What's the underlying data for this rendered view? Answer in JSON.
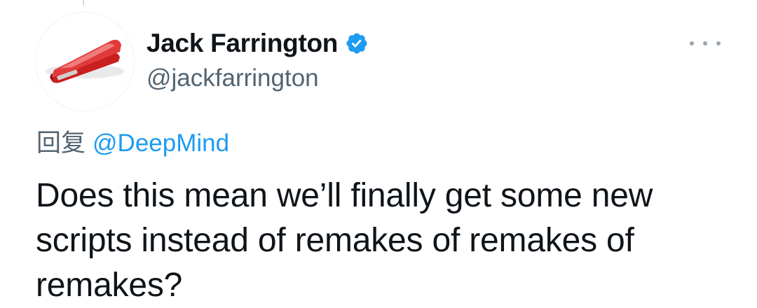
{
  "author": {
    "display_name": "Jack Farrington",
    "handle": "@jackfarrington",
    "verified": true,
    "avatar_icon": "red-stapler-avatar"
  },
  "actions": {
    "more_icon": "more-options-icon"
  },
  "reply_to": {
    "prefix": "回复",
    "mention": "@DeepMind"
  },
  "tweet": {
    "text": "Does this mean we’ll finally get some new scripts instead of remakes of remakes of remakes?"
  },
  "colors": {
    "link_blue": "#1d9bf0",
    "secondary_text": "#536471",
    "primary_text": "#0f1419",
    "stapler_red": "#d42a2a"
  }
}
